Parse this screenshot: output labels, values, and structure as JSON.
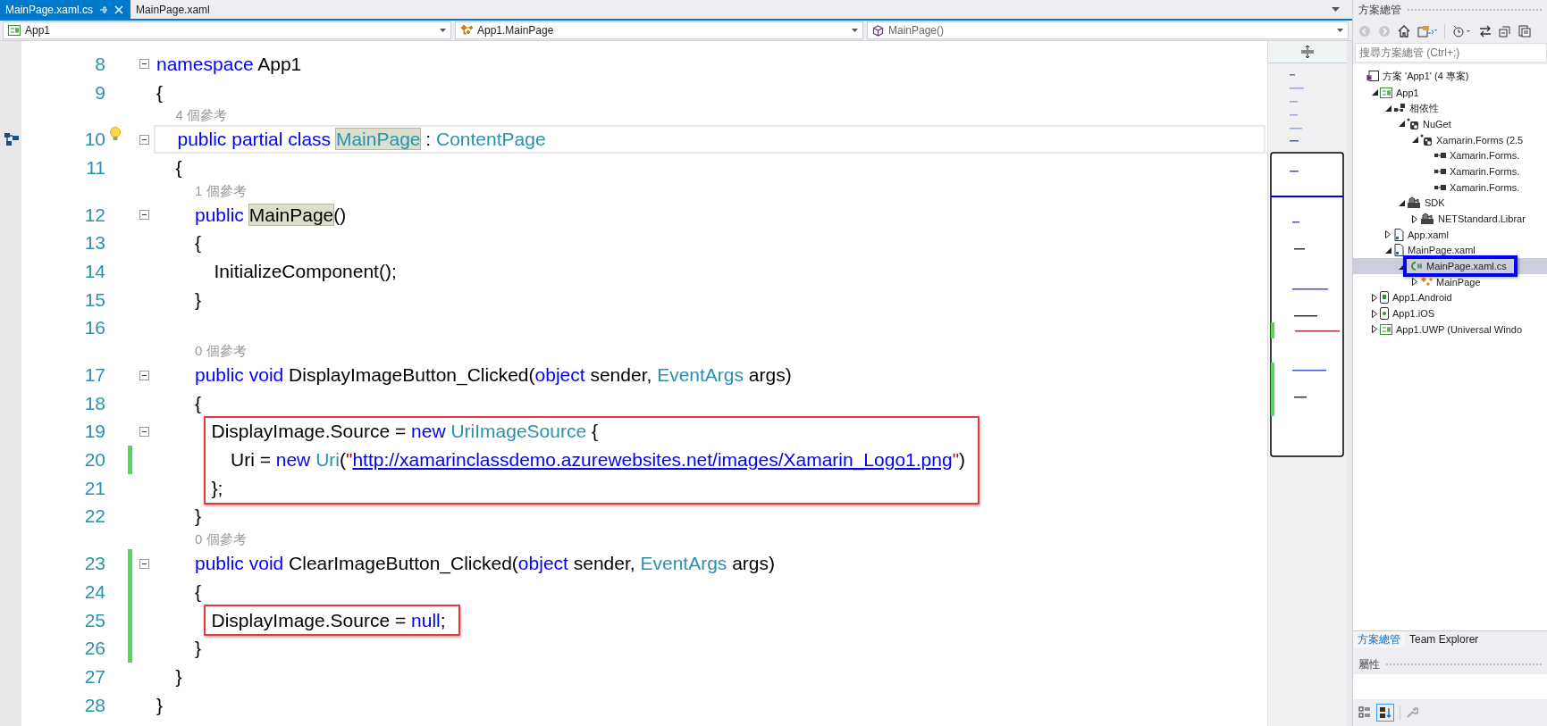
{
  "tabs": [
    {
      "label": "MainPage.xaml.cs",
      "selected": true
    },
    {
      "label": "MainPage.xaml",
      "selected": false
    }
  ],
  "nav_bar": {
    "project": "App1",
    "type": "App1.MainPage",
    "member": "MainPage()"
  },
  "code": {
    "lines": [
      {
        "n": "8",
        "fold": true,
        "changed": false,
        "current": false,
        "boxed": false,
        "tokens": [
          {
            "text": "namespace",
            "kind": "kw"
          },
          {
            "text": " App1",
            "kind": "plain"
          }
        ]
      },
      {
        "n": "9",
        "fold": false,
        "changed": false,
        "current": false,
        "boxed": false,
        "tokens": [
          {
            "text": "{",
            "kind": "plain"
          }
        ],
        "children": [
          {
            "n": "10",
            "fold": true,
            "changed": false,
            "current": true,
            "boxed": false,
            "lens": "4 個參考",
            "glyphs": [
              {
                "kind": "diagram"
              },
              {
                "kind": "bulb"
              }
            ],
            "tokens": [
              {
                "text": "public partial class ",
                "kind": "kw"
              },
              {
                "text": "MainPage",
                "kind": "type-ref"
              },
              {
                "text": " : ",
                "kind": "plain"
              },
              {
                "text": "ContentPage",
                "kind": "type"
              }
            ]
          },
          {
            "n": "11",
            "fold": false,
            "changed": false,
            "current": false,
            "boxed": false,
            "tokens": [
              {
                "text": "{",
                "kind": "plain"
              }
            ],
            "children": [
              {
                "n": "12",
                "fold": true,
                "changed": false,
                "current": false,
                "boxed": false,
                "lens": "1 個參考",
                "tokens": [
                  {
                    "text": "public ",
                    "kind": "kw"
                  },
                  {
                    "text": "MainPage",
                    "kind": "ref"
                  },
                  {
                    "text": "()",
                    "kind": "plain"
                  }
                ]
              },
              {
                "n": "13",
                "fold": false,
                "changed": false,
                "current": false,
                "boxed": false,
                "tokens": [
                  {
                    "text": "{",
                    "kind": "plain"
                  }
                ],
                "children": [
                  {
                    "n": "14",
                    "fold": false,
                    "changed": false,
                    "current": false,
                    "boxed": false,
                    "tokens": [
                      {
                        "text": "InitializeComponent();",
                        "kind": "plain"
                      }
                    ]
                  }
                ]
              },
              {
                "n": "15",
                "fold": false,
                "changed": false,
                "current": false,
                "boxed": false,
                "tokens": [
                  {
                    "text": "}",
                    "kind": "plain"
                  }
                ]
              },
              {
                "n": "16",
                "fold": false,
                "changed": false,
                "current": false,
                "boxed": false
              },
              {
                "n": "17",
                "fold": true,
                "changed": false,
                "current": false,
                "boxed": false,
                "lens": "0 個參考",
                "tokens": [
                  {
                    "text": "public void ",
                    "kind": "kw"
                  },
                  {
                    "text": "DisplayImageButton_Clicked(",
                    "kind": "plain"
                  },
                  {
                    "text": "object",
                    "kind": "kw"
                  },
                  {
                    "text": " sender, ",
                    "kind": "plain"
                  },
                  {
                    "text": "EventArgs",
                    "kind": "type"
                  },
                  {
                    "text": " args)",
                    "kind": "plain"
                  }
                ]
              },
              {
                "n": "18",
                "fold": false,
                "changed": false,
                "current": false,
                "boxed": false,
                "tokens": [
                  {
                    "text": "{",
                    "kind": "plain"
                  }
                ],
                "children": [
                  {
                    "n": "19",
                    "fold": true,
                    "changed": false,
                    "current": false,
                    "boxed": true,
                    "tokens": [
                      {
                        "text": "DisplayImage.Source = ",
                        "kind": "plain"
                      },
                      {
                        "text": "new ",
                        "kind": "kw"
                      },
                      {
                        "text": "UriImageSource",
                        "kind": "type"
                      },
                      {
                        "text": " {",
                        "kind": "plain"
                      }
                    ],
                    "children": [
                      {
                        "n": "20",
                        "fold": false,
                        "changed": true,
                        "current": false,
                        "boxed": true,
                        "tokens": [
                          {
                            "text": "Uri = ",
                            "kind": "plain"
                          },
                          {
                            "text": "new ",
                            "kind": "kw"
                          },
                          {
                            "text": "Uri",
                            "kind": "type"
                          },
                          {
                            "text": "(",
                            "kind": "plain"
                          },
                          {
                            "text": "\"",
                            "kind": "str"
                          },
                          {
                            "text": "http://xamarinclassdemo.azurewebsites.net/images/Xamarin_Logo1.png",
                            "kind": "link"
                          },
                          {
                            "text": "\"",
                            "kind": "str"
                          },
                          {
                            "text": ")",
                            "kind": "plain"
                          }
                        ]
                      }
                    ]
                  },
                  {
                    "n": "21",
                    "fold": false,
                    "changed": false,
                    "current": false,
                    "boxed": true,
                    "tokens": [
                      {
                        "text": "};",
                        "kind": "plain"
                      }
                    ]
                  }
                ]
              },
              {
                "n": "22",
                "fold": false,
                "changed": false,
                "current": false,
                "boxed": false,
                "tokens": [
                  {
                    "text": "}",
                    "kind": "plain"
                  }
                ]
              },
              {
                "n": "23",
                "fold": true,
                "changed": true,
                "current": false,
                "boxed": false,
                "lens": "0 個參考",
                "tokens": [
                  {
                    "text": "public void ",
                    "kind": "kw"
                  },
                  {
                    "text": "ClearImageButton_Clicked(",
                    "kind": "plain"
                  },
                  {
                    "text": "object",
                    "kind": "kw"
                  },
                  {
                    "text": " sender, ",
                    "kind": "plain"
                  },
                  {
                    "text": "EventArgs",
                    "kind": "type"
                  },
                  {
                    "text": " args)",
                    "kind": "plain"
                  }
                ]
              },
              {
                "n": "24",
                "fold": false,
                "changed": true,
                "current": false,
                "boxed": false,
                "tokens": [
                  {
                    "text": "{",
                    "kind": "plain"
                  }
                ],
                "children": [
                  {
                    "n": "25",
                    "fold": false,
                    "changed": true,
                    "current": false,
                    "boxed": true,
                    "tokens": [
                      {
                        "text": "DisplayImage.Source = ",
                        "kind": "plain"
                      },
                      {
                        "text": "null",
                        "kind": "kw"
                      },
                      {
                        "text": ";",
                        "kind": "plain"
                      }
                    ]
                  }
                ]
              },
              {
                "n": "26",
                "fold": false,
                "changed": true,
                "current": false,
                "boxed": false,
                "tokens": [
                  {
                    "text": "}",
                    "kind": "plain"
                  }
                ]
              }
            ]
          },
          {
            "n": "27",
            "fold": false,
            "changed": false,
            "current": false,
            "boxed": false,
            "tokens": [
              {
                "text": "}",
                "kind": "plain"
              }
            ]
          }
        ]
      },
      {
        "n": "28",
        "fold": false,
        "changed": false,
        "current": false,
        "boxed": false,
        "tokens": [
          {
            "text": "}",
            "kind": "plain"
          }
        ]
      }
    ]
  },
  "solution_explorer": {
    "title": "方案總管",
    "search": {
      "placeholder": "搜尋方案總管 (Ctrl+;)"
    },
    "tree": [
      {
        "label": "方案 'App1' (4 專案)",
        "kind": "solution",
        "selected": false,
        "children": [
          {
            "label": "App1",
            "kind": "csproj",
            "expanded": true,
            "selected": false,
            "children": [
              {
                "label": "相依性",
                "kind": "deps",
                "expanded": true,
                "selected": false,
                "children": [
                  {
                    "label": "NuGet",
                    "kind": "nuget",
                    "expanded": true,
                    "selected": false,
                    "children": [
                      {
                        "label": "Xamarin.Forms (2.5",
                        "kind": "nuget",
                        "expanded": true,
                        "selected": false,
                        "children": [
                          {
                            "label": "Xamarin.Forms.",
                            "kind": "assembly",
                            "selected": false
                          },
                          {
                            "label": "Xamarin.Forms.",
                            "kind": "assembly",
                            "selected": false
                          },
                          {
                            "label": "Xamarin.Forms.",
                            "kind": "assembly",
                            "selected": false
                          }
                        ]
                      }
                    ]
                  },
                  {
                    "label": "SDK",
                    "kind": "sdk",
                    "expanded": true,
                    "selected": false,
                    "children": [
                      {
                        "label": "NETStandard.Librar",
                        "kind": "sdk",
                        "expanded": false,
                        "selected": false
                      }
                    ]
                  }
                ]
              },
              {
                "label": "App.xaml",
                "kind": "xaml",
                "expanded": false,
                "selected": false
              },
              {
                "label": "MainPage.xaml",
                "kind": "xaml",
                "expanded": true,
                "selected": false,
                "children": [
                  {
                    "label": "MainPage.xaml.cs",
                    "kind": "cs",
                    "expanded": true,
                    "selected": true,
                    "annotated": true,
                    "children": [
                      {
                        "label": "MainPage",
                        "kind": "class",
                        "expanded": false,
                        "selected": false
                      }
                    ]
                  }
                ]
              }
            ]
          },
          {
            "label": "App1.Android",
            "kind": "android",
            "expanded": false,
            "selected": false
          },
          {
            "label": "App1.iOS",
            "kind": "ios",
            "expanded": false,
            "selected": false
          },
          {
            "label": "App1.UWP (Universal Windo",
            "kind": "csproj",
            "expanded": false,
            "selected": false
          }
        ]
      }
    ],
    "bottom_tabs": [
      {
        "label": "方案總管",
        "selected": true
      },
      {
        "label": "Team Explorer",
        "selected": false
      }
    ]
  },
  "properties": {
    "title": "屬性"
  }
}
